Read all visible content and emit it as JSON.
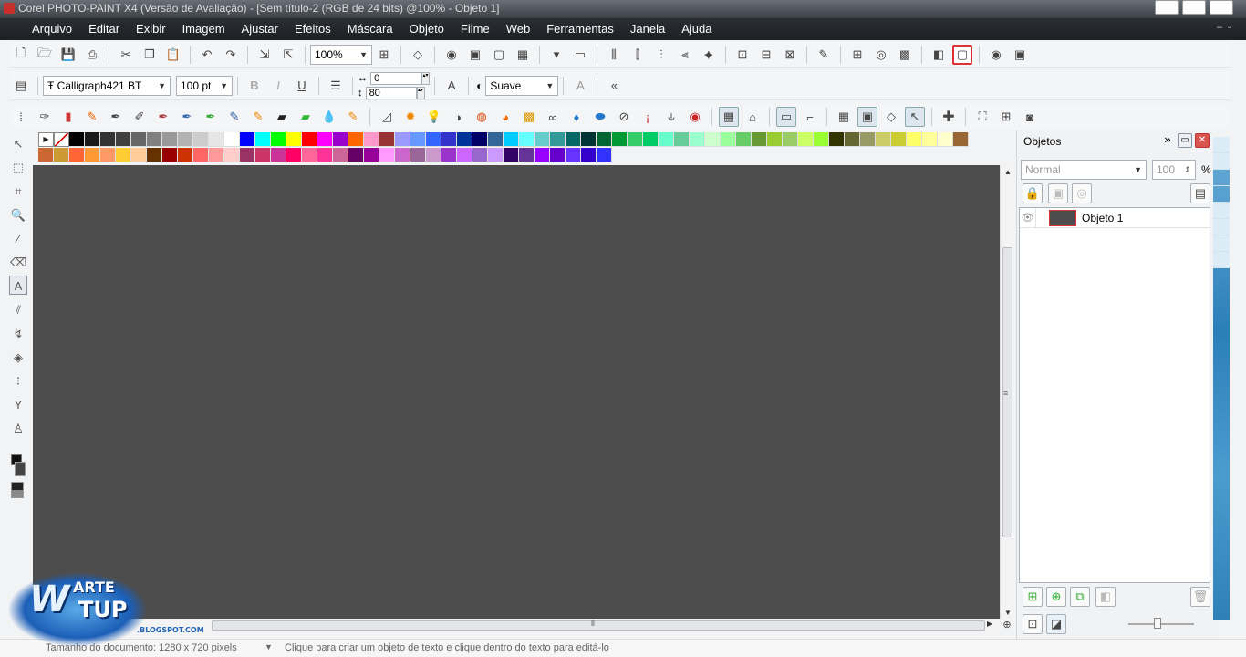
{
  "window": {
    "title": "Corel PHOTO-PAINT X4 (Versão de Avaliação) - [Sem título-2 (RGB de 24 bits) @100% - Objeto 1]"
  },
  "menu": [
    "Arquivo",
    "Editar",
    "Exibir",
    "Imagem",
    "Ajustar",
    "Efeitos",
    "Máscara",
    "Objeto",
    "Filme",
    "Web",
    "Ferramentas",
    "Janela",
    "Ajuda"
  ],
  "toolbar": {
    "zoom": "100%"
  },
  "property_bar": {
    "font_name": "Calligraph421 BT",
    "font_size": "100 pt",
    "kerning": "0",
    "line_spacing": "80",
    "antialias": "Suave"
  },
  "palette": {
    "row1": [
      "#000000",
      "#1a1a1a",
      "#333333",
      "#404040",
      "#666666",
      "#808080",
      "#999999",
      "#b3b3b3",
      "#cccccc",
      "#e6e6e6",
      "#ffffff",
      "#0000ff",
      "#00ffff",
      "#00ff00",
      "#ffff00",
      "#ff0000",
      "#ff00ff",
      "#9900cc",
      "#ff6600",
      "#ff99cc",
      "#993333",
      "#9999ff",
      "#6699ff",
      "#3366ff",
      "#3333cc",
      "#003399",
      "#000066",
      "#336699",
      "#00ccff",
      "#66ffff",
      "#66cccc",
      "#339999",
      "#006666",
      "#003333",
      "#006633",
      "#009933",
      "#33cc66",
      "#00cc66",
      "#66ffcc",
      "#66cc99",
      "#99ffcc",
      "#ccffcc",
      "#99ff99",
      "#66cc66",
      "#669933",
      "#99cc33",
      "#99cc66",
      "#ccff66",
      "#99ff33",
      "#333300",
      "#666633",
      "#999966",
      "#cccc66",
      "#cccc33",
      "#ffff66",
      "#ffff99",
      "#ffffcc",
      "#996633"
    ],
    "row2": [
      "#cc6633",
      "#cc9933",
      "#ff6633",
      "#ff9933",
      "#ff9966",
      "#ffcc33",
      "#ffcc99",
      "#663300",
      "#990000",
      "#cc3300",
      "#ff6666",
      "#ff9999",
      "#ffcccc",
      "#993366",
      "#cc3366",
      "#cc3399",
      "#ff0066",
      "#ff6699",
      "#ff3399",
      "#cc6699",
      "#660066",
      "#990099",
      "#ff99ff",
      "#cc66cc",
      "#996699",
      "#cc99cc",
      "#9933cc",
      "#cc66ff",
      "#9966cc",
      "#cc99ff",
      "#330066",
      "#663399",
      "#9900ff",
      "#6600cc",
      "#6633ff",
      "#3300cc",
      "#3333ff"
    ]
  },
  "docker": {
    "title": "Objetos",
    "blend_mode": "Normal",
    "opacity": "100",
    "opacity_unit": "%",
    "layers": [
      {
        "name": "Objeto 1"
      }
    ]
  },
  "statusbar": {
    "doc_size": "Tamanho do documento: 1280 x 720 pixels",
    "hint": "Clique para criar um objeto de texto e clique dentro do texto para editá-lo"
  },
  "logo": {
    "letters": "W",
    "arte": "ARTE",
    "tup": "TUP",
    "blog": ".BLOGSPOT.COM"
  }
}
